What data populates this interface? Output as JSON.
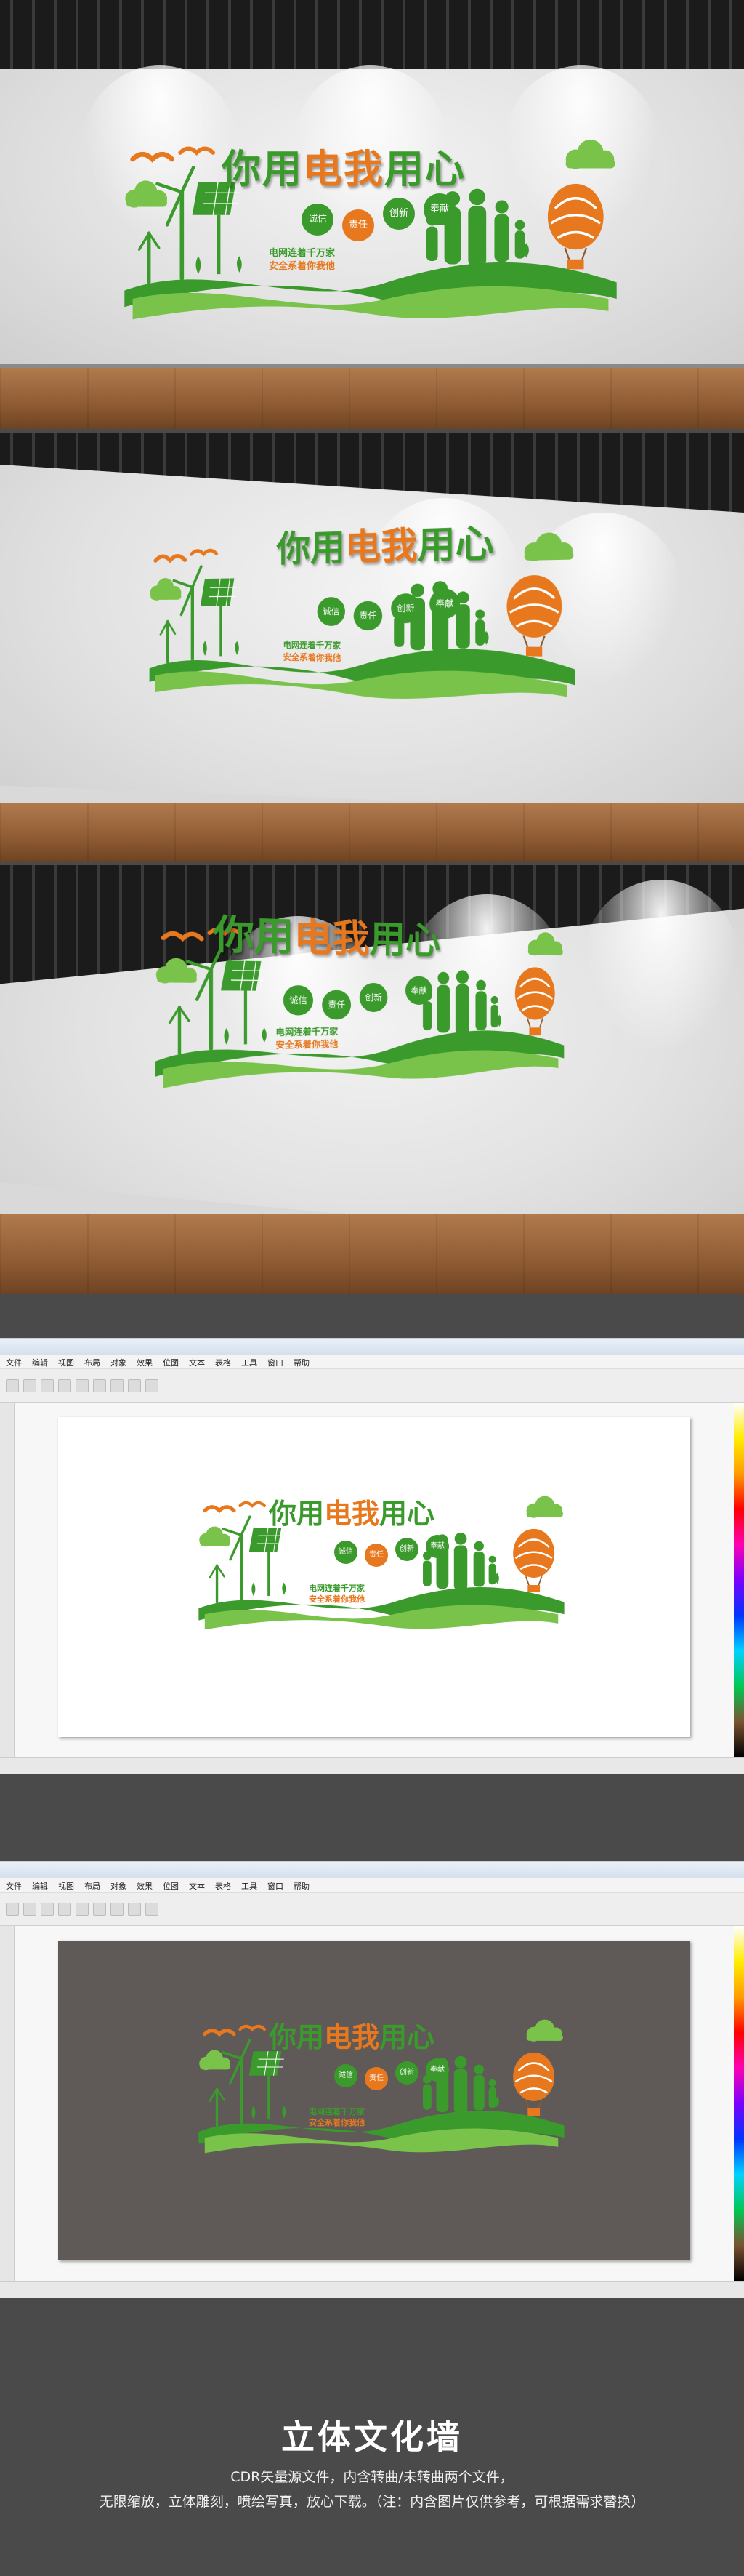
{
  "sign": {
    "title_part_green1": "你用",
    "title_part_orange": "电我",
    "title_part_green2": "用心",
    "values": [
      "诚信",
      "责任",
      "创新",
      "奉献"
    ],
    "slogan_line1": "电网连着千万家",
    "slogan_line2": "安全系着你我他"
  },
  "app": {
    "menu_items": [
      "文件",
      "编辑",
      "视图",
      "布局",
      "对象",
      "效果",
      "位图",
      "文本",
      "表格",
      "工具",
      "窗口",
      "帮助"
    ]
  },
  "footer": {
    "title": "立体文化墙",
    "line1": "CDR矢量源文件，内含转曲/未转曲两个文件，",
    "line2": "无限缩放，立体雕刻，喷绘写真，放心下载。（注：内含图片仅供参考，可根据需求替换）"
  },
  "colors": {
    "green": "#3a9a2b",
    "light_green": "#79c34a",
    "orange": "#e8781e",
    "gray_bg": "#4a4a4a",
    "dark_canvas": "#5f5a57"
  }
}
